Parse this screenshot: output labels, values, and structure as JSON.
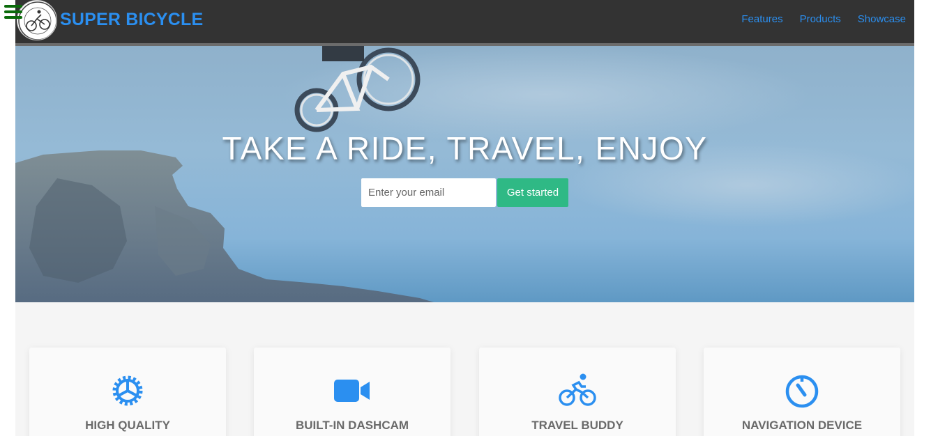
{
  "navbar": {
    "brand": "SUPER BICYCLE",
    "links": [
      "Features",
      "Products",
      "Showcase"
    ]
  },
  "logo": {
    "icon": "mountain-bike-logo",
    "alt": "Mountain Adventure"
  },
  "hero": {
    "title": "TAKE A RIDE, TRAVEL, ENJOY",
    "email_placeholder": "Enter your email",
    "cta_label": "Get started"
  },
  "features": [
    {
      "icon": "gear-icon",
      "title": "HIGH QUALITY"
    },
    {
      "icon": "video-camera-icon",
      "title": "BUILT-IN DASHCAM"
    },
    {
      "icon": "cyclist-icon",
      "title": "TRAVEL BUDDY"
    },
    {
      "icon": "stopwatch-icon",
      "title": "NAVIGATION DEVICE"
    }
  ],
  "colors": {
    "accent": "#2b8ff0",
    "cta": "#2fb985",
    "navbar": "#333333"
  }
}
